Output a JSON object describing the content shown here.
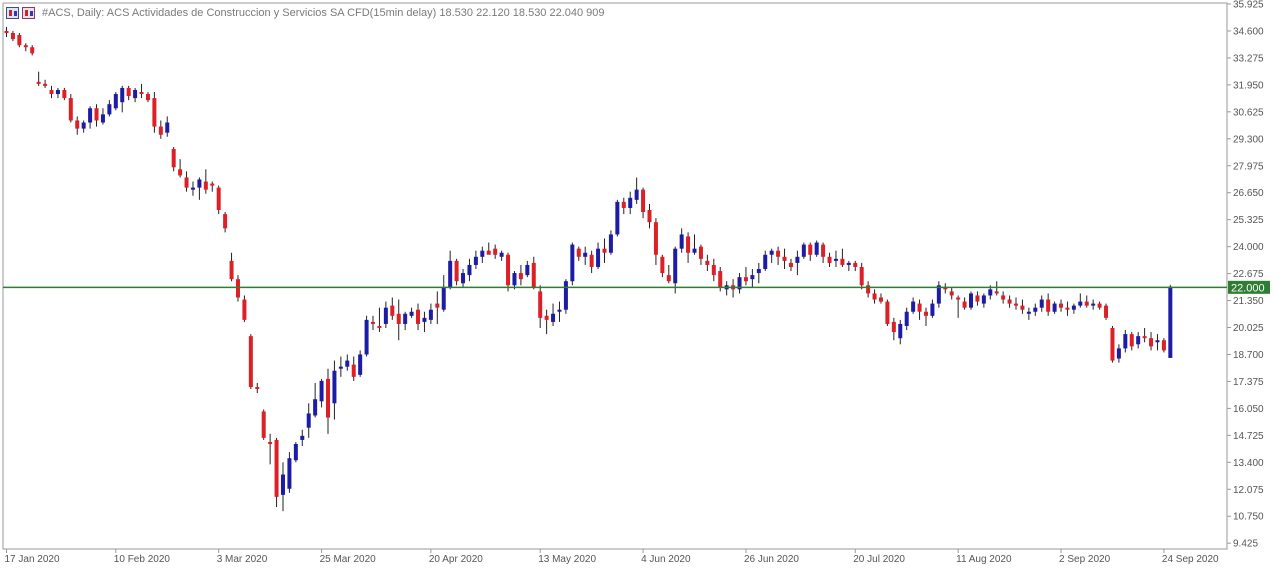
{
  "header": {
    "text": "#ACS, Daily:  ACS Actividades de Construccion y Servicios SA CFD(15min delay)  18.530 22.120 18.530 22.040  909"
  },
  "colors": {
    "bull": "#1c1ca6",
    "bear": "#dd1f26",
    "wick": "#222222",
    "level_line": "#2e7d32",
    "grid_frame": "#9a9a9a"
  },
  "chart_data": {
    "type": "candlestick",
    "symbol": "#ACS",
    "timeframe": "Daily",
    "ohlc_header": {
      "open": 18.53,
      "high": 22.12,
      "low": 18.53,
      "close": 22.04,
      "volume": 909
    },
    "ylim": [
      8.5,
      35.925
    ],
    "y_ticks": [
      "35.925",
      "34.600",
      "33.275",
      "31.950",
      "30.625",
      "29.300",
      "27.975",
      "26.650",
      "25.325",
      "24.000",
      "22.675",
      "21.350",
      "20.025",
      "18.700",
      "17.375",
      "16.050",
      "14.725",
      "13.400",
      "12.075",
      "10.750",
      "9.425"
    ],
    "x_ticks": [
      {
        "label": "17 Jan 2020",
        "index": 0
      },
      {
        "label": "10 Feb 2020",
        "index": 17
      },
      {
        "label": "3 Mar 2020",
        "index": 33
      },
      {
        "label": "25 Mar 2020",
        "index": 49
      },
      {
        "label": "20 Apr 2020",
        "index": 66
      },
      {
        "label": "13 May 2020",
        "index": 83
      },
      {
        "label": "4 Jun 2020",
        "index": 99
      },
      {
        "label": "26 Jun 2020",
        "index": 115
      },
      {
        "label": "20 Jul 2020",
        "index": 132
      },
      {
        "label": "11 Aug 2020",
        "index": 148
      },
      {
        "label": "2 Sep 2020",
        "index": 164
      },
      {
        "label": "24 Sep 2020",
        "index": 180
      }
    ],
    "horizontal_line": {
      "value": 22.0,
      "label": "22.000"
    },
    "candles": [
      [
        34.6,
        34.8,
        34.3,
        34.5
      ],
      [
        34.5,
        34.6,
        34.1,
        34.2
      ],
      [
        34.4,
        34.5,
        33.8,
        33.9
      ],
      [
        33.9,
        34.0,
        33.6,
        33.8
      ],
      [
        33.8,
        33.9,
        33.4,
        33.5
      ],
      [
        32.1,
        32.6,
        31.9,
        32.0
      ],
      [
        32.0,
        32.2,
        31.8,
        31.9
      ],
      [
        31.7,
        31.9,
        31.3,
        31.5
      ],
      [
        31.5,
        31.8,
        31.3,
        31.7
      ],
      [
        31.7,
        31.8,
        31.2,
        31.3
      ],
      [
        31.3,
        31.5,
        30.1,
        30.2
      ],
      [
        30.2,
        30.4,
        29.5,
        29.8
      ],
      [
        29.8,
        30.2,
        29.6,
        30.1
      ],
      [
        30.1,
        30.9,
        29.8,
        30.8
      ],
      [
        30.8,
        31.0,
        29.9,
        30.2
      ],
      [
        30.1,
        30.8,
        30.0,
        30.5
      ],
      [
        30.5,
        31.2,
        30.4,
        31.0
      ],
      [
        30.8,
        31.6,
        30.7,
        31.5
      ],
      [
        31.1,
        31.9,
        30.6,
        31.8
      ],
      [
        31.8,
        31.9,
        31.2,
        31.4
      ],
      [
        31.3,
        31.8,
        31.1,
        31.7
      ],
      [
        31.6,
        32.0,
        31.3,
        31.5
      ],
      [
        31.5,
        31.6,
        31.1,
        31.2
      ],
      [
        31.3,
        31.6,
        29.6,
        29.9
      ],
      [
        29.9,
        30.2,
        29.3,
        29.5
      ],
      [
        29.6,
        30.4,
        29.4,
        30.1
      ],
      [
        28.8,
        28.9,
        27.7,
        27.9
      ],
      [
        27.8,
        28.3,
        27.4,
        27.5
      ],
      [
        27.4,
        27.7,
        26.7,
        26.9
      ],
      [
        26.8,
        27.2,
        26.5,
        26.9
      ],
      [
        26.9,
        27.4,
        26.3,
        27.3
      ],
      [
        27.2,
        27.8,
        26.6,
        26.8
      ],
      [
        27.1,
        27.2,
        26.7,
        27.0
      ],
      [
        26.9,
        27.0,
        25.6,
        25.8
      ],
      [
        25.6,
        25.7,
        24.7,
        24.9
      ],
      [
        23.3,
        23.7,
        22.3,
        22.4
      ],
      [
        22.4,
        22.6,
        21.3,
        21.5
      ],
      [
        21.4,
        21.6,
        20.3,
        20.4
      ],
      [
        19.6,
        19.7,
        17.0,
        17.1
      ],
      [
        17.1,
        17.3,
        16.8,
        17.0
      ],
      [
        15.9,
        16.0,
        14.5,
        14.6
      ],
      [
        14.4,
        14.8,
        13.3,
        14.3
      ],
      [
        14.5,
        14.6,
        11.2,
        11.7
      ],
      [
        11.8,
        13.4,
        11.0,
        12.8
      ],
      [
        12.1,
        13.9,
        11.9,
        13.6
      ],
      [
        13.5,
        14.4,
        13.4,
        14.3
      ],
      [
        14.5,
        15.0,
        14.2,
        14.7
      ],
      [
        15.1,
        16.3,
        14.6,
        15.8
      ],
      [
        15.7,
        17.3,
        15.6,
        16.5
      ],
      [
        16.4,
        17.5,
        16.1,
        17.4
      ],
      [
        17.5,
        18.0,
        14.8,
        15.6
      ],
      [
        16.3,
        18.4,
        15.5,
        17.9
      ],
      [
        18.0,
        18.6,
        17.6,
        18.1
      ],
      [
        18.1,
        18.7,
        17.9,
        18.4
      ],
      [
        18.2,
        18.6,
        17.4,
        17.6
      ],
      [
        17.7,
        18.9,
        17.6,
        18.7
      ],
      [
        18.7,
        20.6,
        18.6,
        20.4
      ],
      [
        20.3,
        20.6,
        19.9,
        20.2
      ],
      [
        20.1,
        21.0,
        19.8,
        20.0
      ],
      [
        20.2,
        21.3,
        20.0,
        21.0
      ],
      [
        21.1,
        21.5,
        20.4,
        20.6
      ],
      [
        20.7,
        21.4,
        19.4,
        20.2
      ],
      [
        20.2,
        20.8,
        19.9,
        20.7
      ],
      [
        20.6,
        21.0,
        20.5,
        20.8
      ],
      [
        20.9,
        21.2,
        19.9,
        20.2
      ],
      [
        20.3,
        20.8,
        19.8,
        20.5
      ],
      [
        20.4,
        21.2,
        20.2,
        20.9
      ],
      [
        21.2,
        21.8,
        20.2,
        21.0
      ],
      [
        20.9,
        22.6,
        20.8,
        22.0
      ],
      [
        22.0,
        23.8,
        21.9,
        23.3
      ],
      [
        23.3,
        23.4,
        22.1,
        22.3
      ],
      [
        22.2,
        22.9,
        22.0,
        22.7
      ],
      [
        22.6,
        23.4,
        22.3,
        23.1
      ],
      [
        23.1,
        23.8,
        22.9,
        23.5
      ],
      [
        23.5,
        24.0,
        23.2,
        23.8
      ],
      [
        23.8,
        24.2,
        23.7,
        23.6
      ],
      [
        23.9,
        24.1,
        23.4,
        23.6
      ],
      [
        23.5,
        23.8,
        23.3,
        23.7
      ],
      [
        23.6,
        23.7,
        21.8,
        22.1
      ],
      [
        22.1,
        22.8,
        21.9,
        22.7
      ],
      [
        22.7,
        23.1,
        22.1,
        22.4
      ],
      [
        22.6,
        23.3,
        22.5,
        23.1
      ],
      [
        23.2,
        23.5,
        21.9,
        22.0
      ],
      [
        21.8,
        22.1,
        20.0,
        20.5
      ],
      [
        20.6,
        20.9,
        19.7,
        20.4
      ],
      [
        20.3,
        21.2,
        20.1,
        20.7
      ],
      [
        20.8,
        21.3,
        20.3,
        20.9
      ],
      [
        20.9,
        22.4,
        20.7,
        22.3
      ],
      [
        22.3,
        24.2,
        22.1,
        24.1
      ],
      [
        23.9,
        24.0,
        23.3,
        23.5
      ],
      [
        23.5,
        24.0,
        23.1,
        23.7
      ],
      [
        23.6,
        23.8,
        22.7,
        23.0
      ],
      [
        23.0,
        24.2,
        22.9,
        23.9
      ],
      [
        23.9,
        24.4,
        23.2,
        23.7
      ],
      [
        23.7,
        24.8,
        23.6,
        24.6
      ],
      [
        24.6,
        26.3,
        24.5,
        26.2
      ],
      [
        26.2,
        26.4,
        25.6,
        25.9
      ],
      [
        25.9,
        26.7,
        25.6,
        26.4
      ],
      [
        26.3,
        27.4,
        26.1,
        26.8
      ],
      [
        26.8,
        26.9,
        25.4,
        25.7
      ],
      [
        25.8,
        26.1,
        24.9,
        25.2
      ],
      [
        25.2,
        25.4,
        23.1,
        23.6
      ],
      [
        23.5,
        23.6,
        22.5,
        22.7
      ],
      [
        22.6,
        23.1,
        22.2,
        22.3
      ],
      [
        22.2,
        24.0,
        21.7,
        23.9
      ],
      [
        23.9,
        24.9,
        23.7,
        24.6
      ],
      [
        24.5,
        24.7,
        23.2,
        23.7
      ],
      [
        23.7,
        24.6,
        23.6,
        23.9
      ],
      [
        24.0,
        24.1,
        23.1,
        23.4
      ],
      [
        23.3,
        23.6,
        22.8,
        23.1
      ],
      [
        23.1,
        23.4,
        22.3,
        22.6
      ],
      [
        22.8,
        23.0,
        21.8,
        22.0
      ],
      [
        21.9,
        22.3,
        21.6,
        22.1
      ],
      [
        22.1,
        22.4,
        21.5,
        21.9
      ],
      [
        21.9,
        22.7,
        21.7,
        22.5
      ],
      [
        22.5,
        23.0,
        22.1,
        22.3
      ],
      [
        22.4,
        22.9,
        22.0,
        22.6
      ],
      [
        22.7,
        23.2,
        22.2,
        22.9
      ],
      [
        22.9,
        23.8,
        22.8,
        23.6
      ],
      [
        23.6,
        23.9,
        23.2,
        23.8
      ],
      [
        23.8,
        24.0,
        23.1,
        23.5
      ],
      [
        23.5,
        23.9,
        22.9,
        23.3
      ],
      [
        23.2,
        23.4,
        22.8,
        23.0
      ],
      [
        23.2,
        23.8,
        22.6,
        23.5
      ],
      [
        23.5,
        24.2,
        23.4,
        24.1
      ],
      [
        24.1,
        24.2,
        23.3,
        23.6
      ],
      [
        23.6,
        24.3,
        23.5,
        24.2
      ],
      [
        24.1,
        24.2,
        23.2,
        23.5
      ],
      [
        23.5,
        23.7,
        23.0,
        23.2
      ],
      [
        23.3,
        23.8,
        23.0,
        23.4
      ],
      [
        23.4,
        23.9,
        23.0,
        23.1
      ],
      [
        23.1,
        23.3,
        22.8,
        23.2
      ],
      [
        23.2,
        23.3,
        22.8,
        23.0
      ],
      [
        23.0,
        23.2,
        21.9,
        22.1
      ],
      [
        22.1,
        22.3,
        21.5,
        21.7
      ],
      [
        21.7,
        21.9,
        21.2,
        21.4
      ],
      [
        21.5,
        21.7,
        21.2,
        21.3
      ],
      [
        21.3,
        21.4,
        20.1,
        20.2
      ],
      [
        20.3,
        20.5,
        19.4,
        19.8
      ],
      [
        19.5,
        20.4,
        19.2,
        20.2
      ],
      [
        20.1,
        21.0,
        19.9,
        20.8
      ],
      [
        20.8,
        21.5,
        20.7,
        21.3
      ],
      [
        21.2,
        21.4,
        20.4,
        20.8
      ],
      [
        20.8,
        21.0,
        20.1,
        20.6
      ],
      [
        20.6,
        21.4,
        20.5,
        21.2
      ],
      [
        21.2,
        22.3,
        21.0,
        22.1
      ],
      [
        22.0,
        22.2,
        21.7,
        21.9
      ],
      [
        21.8,
        22.0,
        21.4,
        21.6
      ],
      [
        21.5,
        21.6,
        20.5,
        21.4
      ],
      [
        21.3,
        21.5,
        20.9,
        21.0
      ],
      [
        21.0,
        21.8,
        20.9,
        21.7
      ],
      [
        21.6,
        21.8,
        21.1,
        21.3
      ],
      [
        21.2,
        21.7,
        21.0,
        21.6
      ],
      [
        21.6,
        22.1,
        21.4,
        21.9
      ],
      [
        21.8,
        22.3,
        21.6,
        21.7
      ],
      [
        21.6,
        21.8,
        21.2,
        21.4
      ],
      [
        21.4,
        21.6,
        21.0,
        21.2
      ],
      [
        21.2,
        21.5,
        20.9,
        21.1
      ],
      [
        21.1,
        21.4,
        20.7,
        20.9
      ],
      [
        20.7,
        21.0,
        20.4,
        20.8
      ],
      [
        20.8,
        21.2,
        20.6,
        21.0
      ],
      [
        21.0,
        21.6,
        20.8,
        21.4
      ],
      [
        21.4,
        21.7,
        20.6,
        20.8
      ],
      [
        20.8,
        21.3,
        20.7,
        21.2
      ],
      [
        21.2,
        21.4,
        20.8,
        21.0
      ],
      [
        21.0,
        21.3,
        20.6,
        20.9
      ],
      [
        20.9,
        21.2,
        20.7,
        21.1
      ],
      [
        21.1,
        21.7,
        21.0,
        21.3
      ],
      [
        21.3,
        21.6,
        21.0,
        21.1
      ],
      [
        21.1,
        21.4,
        20.9,
        21.2
      ],
      [
        21.2,
        21.3,
        20.9,
        21.0
      ],
      [
        21.1,
        21.2,
        20.4,
        20.5
      ],
      [
        20.0,
        20.1,
        18.3,
        18.4
      ],
      [
        18.5,
        19.2,
        18.3,
        19.0
      ],
      [
        19.0,
        19.9,
        18.8,
        19.7
      ],
      [
        19.7,
        19.8,
        18.9,
        19.1
      ],
      [
        19.2,
        19.8,
        19.0,
        19.6
      ],
      [
        19.6,
        20.0,
        19.3,
        19.5
      ],
      [
        19.5,
        19.8,
        18.9,
        19.1
      ],
      [
        19.3,
        19.7,
        18.9,
        19.4
      ],
      [
        19.4,
        19.5,
        18.8,
        18.9
      ],
      [
        18.53,
        22.12,
        18.53,
        22.04
      ]
    ]
  }
}
